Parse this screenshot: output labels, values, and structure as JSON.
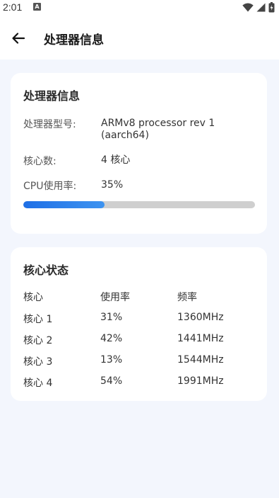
{
  "status_bar": {
    "time": "2:01",
    "notification_icon": "A",
    "icons": [
      "wifi-icon",
      "signal-icon",
      "battery-icon"
    ]
  },
  "app_bar": {
    "back_icon": "arrow-left-icon",
    "title": "处理器信息"
  },
  "processor_card": {
    "title": "处理器信息",
    "model_label": "处理器型号:",
    "model_value_line1": "ARMv8 processor rev 1",
    "model_value_line2": "(aarch64)",
    "cores_label": "核心数:",
    "cores_value": "4 核心",
    "usage_label": "CPU使用率:",
    "usage_value": "35%",
    "usage_fraction": 0.35,
    "progress_color": "#2a7fe9"
  },
  "core_status_card": {
    "title": "核心状态",
    "headers": [
      "核心",
      "使用率",
      "频率"
    ],
    "rows": [
      {
        "core": "核心 1",
        "usage": "31%",
        "freq": "1360MHz"
      },
      {
        "core": "核心 2",
        "usage": "42%",
        "freq": "1441MHz"
      },
      {
        "core": "核心 3",
        "usage": "13%",
        "freq": "1544MHz"
      },
      {
        "core": "核心 4",
        "usage": "54%",
        "freq": "1991MHz"
      }
    ]
  }
}
